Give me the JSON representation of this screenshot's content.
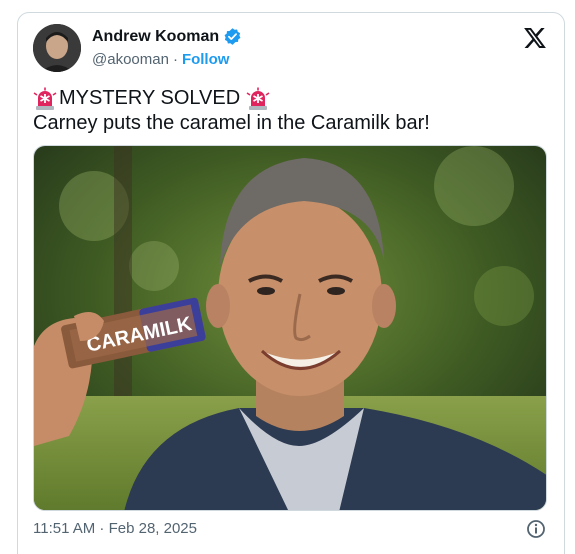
{
  "author": {
    "name": "Andrew Kooman",
    "handle": "@akooman",
    "separator": "·",
    "follow_label": "Follow"
  },
  "tweet": {
    "headline": "MYSTERY SOLVED",
    "body": "Carney puts the caramel in the Caramilk bar!"
  },
  "media": {
    "wrapper_brand": "CARAMILK"
  },
  "meta": {
    "timestamp": "11:51 AM · Feb 28, 2025"
  },
  "icons": {
    "verified": "verified-badge-icon",
    "x_logo": "x-logo-icon",
    "siren": "police-siren-emoji",
    "info": "info-icon"
  },
  "colors": {
    "accent": "#1d9bf0",
    "secondary_text": "#536471",
    "siren_red": "#e0245e"
  }
}
